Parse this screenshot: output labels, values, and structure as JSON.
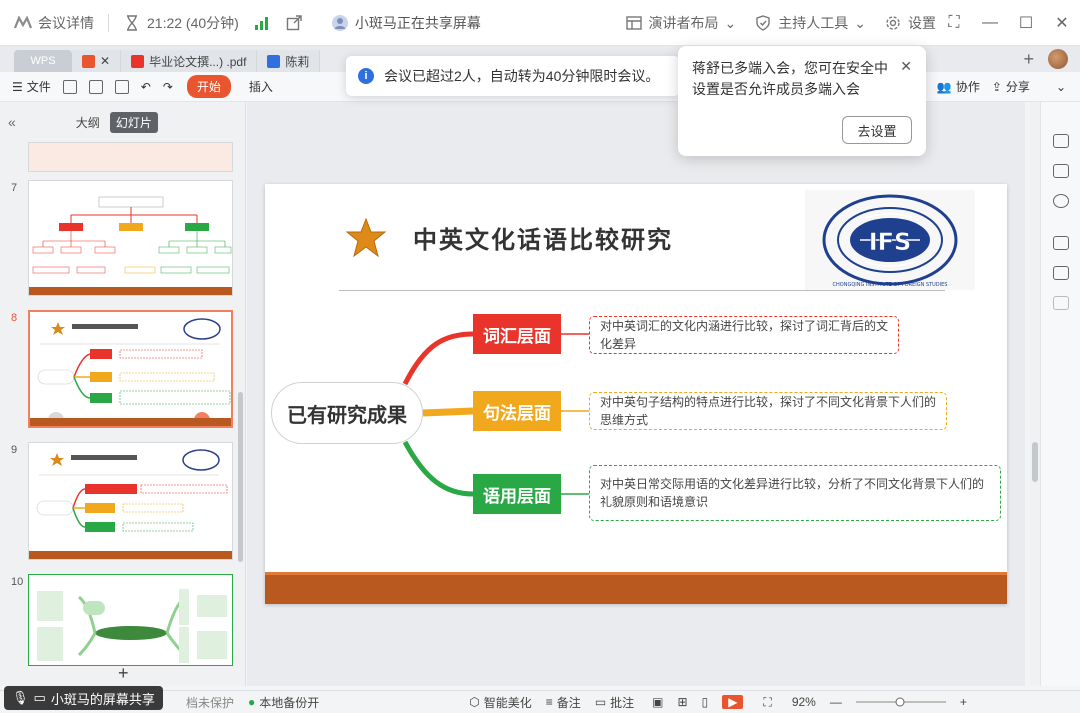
{
  "meeting": {
    "details_label": "会议详情",
    "timer": "21:22 (40分钟)",
    "share_label": "小斑马正在共享屏幕",
    "presenter_layout": "演讲者布局",
    "host_tools": "主持人工具",
    "settings": "设置"
  },
  "tabs": {
    "wps": "WPS",
    "doc1": "毕业论文撰...) .pdf",
    "doc2": "陈莉"
  },
  "ribbon": {
    "file": "文件",
    "start": "开始",
    "insert": "插入",
    "collaborate": "协作",
    "share": "分享"
  },
  "panel": {
    "outline_tab": "大纲",
    "slides_tab": "幻灯片",
    "slide_numbers": [
      "7",
      "8",
      "9",
      "10"
    ]
  },
  "slide": {
    "title": "中英文化话语比较研究",
    "center": "已有研究成果",
    "branches": [
      {
        "label": "词汇层面",
        "desc": "对中英词汇的文化内涵进行比较，探讨了词汇背后的文化差异"
      },
      {
        "label": "句法层面",
        "desc": "对中英句子结构的特点进行比较，探讨了不同文化背景下人们的思维方式"
      },
      {
        "label": "语用层面",
        "desc": "对中英日常交际用语的文化差异进行比较，分析了不同文化背景下人们的礼貌原则和语境意识"
      }
    ],
    "logo_text": "IFS",
    "logo_ring": "CHONGQING INSTITUTE OF FOREIGN STUDIES"
  },
  "toast_info": "会议已超过2人，自动转为40分钟限时会议。",
  "toast_card": {
    "message": "蒋舒已多端入会，您可在安全中设置是否允许成员多端入会",
    "button": "去设置"
  },
  "status": {
    "share_pill": "小斑马的屏幕共享",
    "doc_protect": "档未保护",
    "backup": "本地备份开",
    "beautify": "智能美化",
    "notes": "备注",
    "comments": "批注",
    "zoom": "92%"
  },
  "colors": {
    "accent": "#e9552f",
    "red": "#e8342a",
    "orange": "#f2a81d",
    "green": "#2aa846",
    "footer": "#b9581f"
  }
}
